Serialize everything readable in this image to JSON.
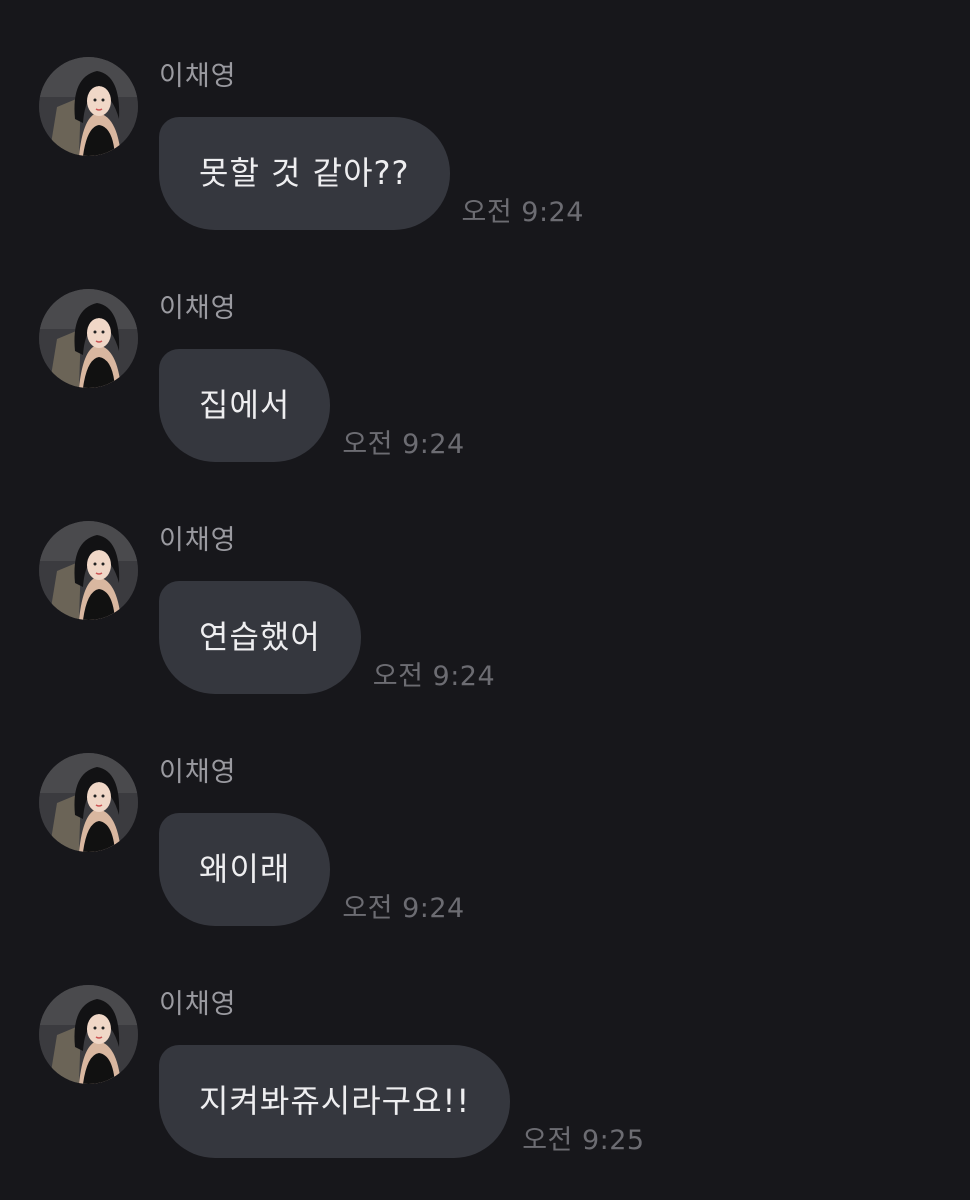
{
  "messages": [
    {
      "sender": "이채영",
      "text": "못할 것 같아??",
      "time": "오전 9:24"
    },
    {
      "sender": "이채영",
      "text": "집에서",
      "time": "오전 9:24"
    },
    {
      "sender": "이채영",
      "text": "연습했어",
      "time": "오전 9:24"
    },
    {
      "sender": "이채영",
      "text": "왜이래",
      "time": "오전 9:24"
    },
    {
      "sender": "이채영",
      "text": "지켜봐쥬시라구요!!",
      "time": "오전 9:25"
    }
  ],
  "colors": {
    "background": "#17171b",
    "bubble": "#35373e",
    "bubble_text": "#eeeef0",
    "sender_text": "#9a9aa0",
    "time_text": "#6c6c72"
  },
  "icons": {
    "avatar": "profile-photo-avatar"
  }
}
